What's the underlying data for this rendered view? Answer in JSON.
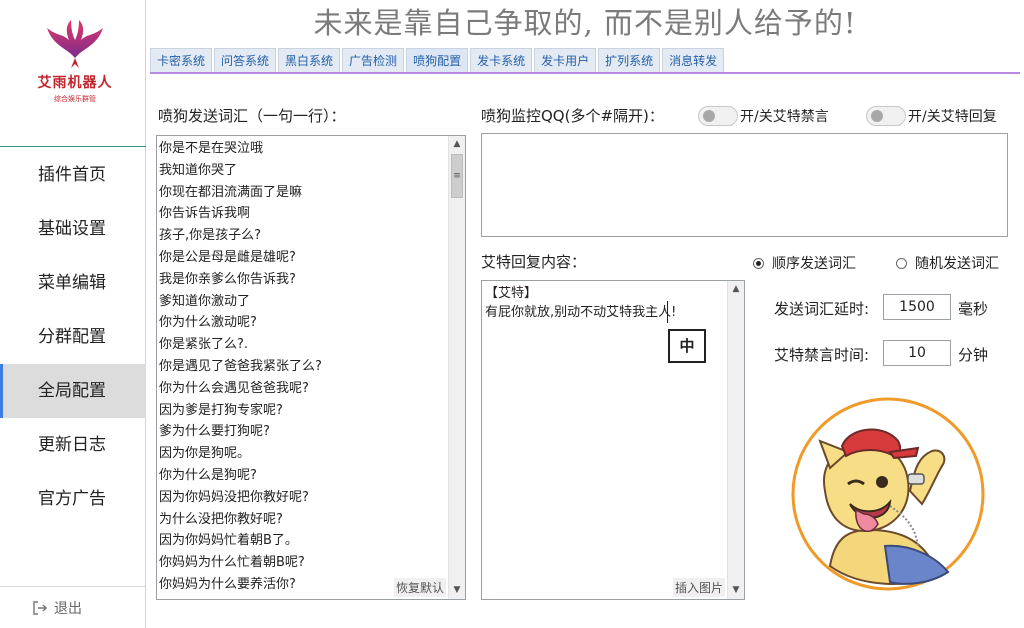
{
  "header": {
    "title": "未来是靠自己争取的, 而不是别人给予的!"
  },
  "logo": {
    "title": "艾雨机器人",
    "subtitle": "综合娱乐群管"
  },
  "sidebar": {
    "items": [
      {
        "label": "插件首页"
      },
      {
        "label": "基础设置"
      },
      {
        "label": "菜单编辑"
      },
      {
        "label": "分群配置"
      },
      {
        "label": "全局配置"
      },
      {
        "label": "更新日志"
      },
      {
        "label": "官方广告"
      }
    ],
    "active_index": 4,
    "logout_label": "退出"
  },
  "tabs": [
    {
      "label": "卡密系统"
    },
    {
      "label": "问答系统"
    },
    {
      "label": "黑白系统"
    },
    {
      "label": "广告检测"
    },
    {
      "label": "喷狗配置"
    },
    {
      "label": "发卡系统"
    },
    {
      "label": "发卡用户"
    },
    {
      "label": "扩列系统"
    },
    {
      "label": "消息转发"
    }
  ],
  "words_panel": {
    "label": "喷狗发送词汇（一句一行）：",
    "lines": [
      "你是不是在哭泣哦",
      "我知道你哭了",
      "你现在都泪流满面了是嘛",
      "你告诉告诉我啊",
      "孩子,你是孩子么?",
      "你是公是母是雌是雄呢?",
      "我是你亲爹么你告诉我?",
      "爹知道你激动了",
      "你为什么激动呢?",
      "你是紧张了么?.",
      "你是遇见了爸爸我紧张了么?",
      "你为什么会遇见爸爸我呢?",
      "因为爹是打狗专家呢?",
      "爹为什么要打狗呢?",
      "因为你是狗呢。",
      "你为什么是狗呢?",
      "因为你妈妈没把你教好呢?",
      "为什么没把你教好呢?",
      "因为你妈妈忙着朝B了。",
      "你妈妈为什么忙着朝B呢?",
      "你妈妈为什么要养活你?"
    ],
    "restore_label": "恢复默认"
  },
  "monitor": {
    "label": "喷狗监控QQ(多个#隔开)：",
    "value": "",
    "toggle_ban_label": "开/关艾特禁言",
    "toggle_ban_on": false,
    "toggle_reply_label": "开/关艾特回复",
    "toggle_reply_on": false
  },
  "reply": {
    "label": "艾特回复内容：",
    "lines": [
      "【艾特】",
      "有屁你就放,别动不动艾特我主人!"
    ],
    "insert_image_label": "插入图片",
    "ime_indicator": "中"
  },
  "options": {
    "order_label": "顺序发送词汇",
    "random_label": "随机发送词汇",
    "selected": "order",
    "delay_label": "发送词汇延时:",
    "delay_value": "1500",
    "delay_unit": "毫秒",
    "ban_time_label": "艾特禁言时间:",
    "ban_time_value": "10",
    "ban_time_unit": "分钟"
  },
  "colors": {
    "accent_line": "#b68ae4",
    "active_indicator": "#3b7de0",
    "logo_red": "#c0262d",
    "mascot_ring": "#f09a2a"
  }
}
